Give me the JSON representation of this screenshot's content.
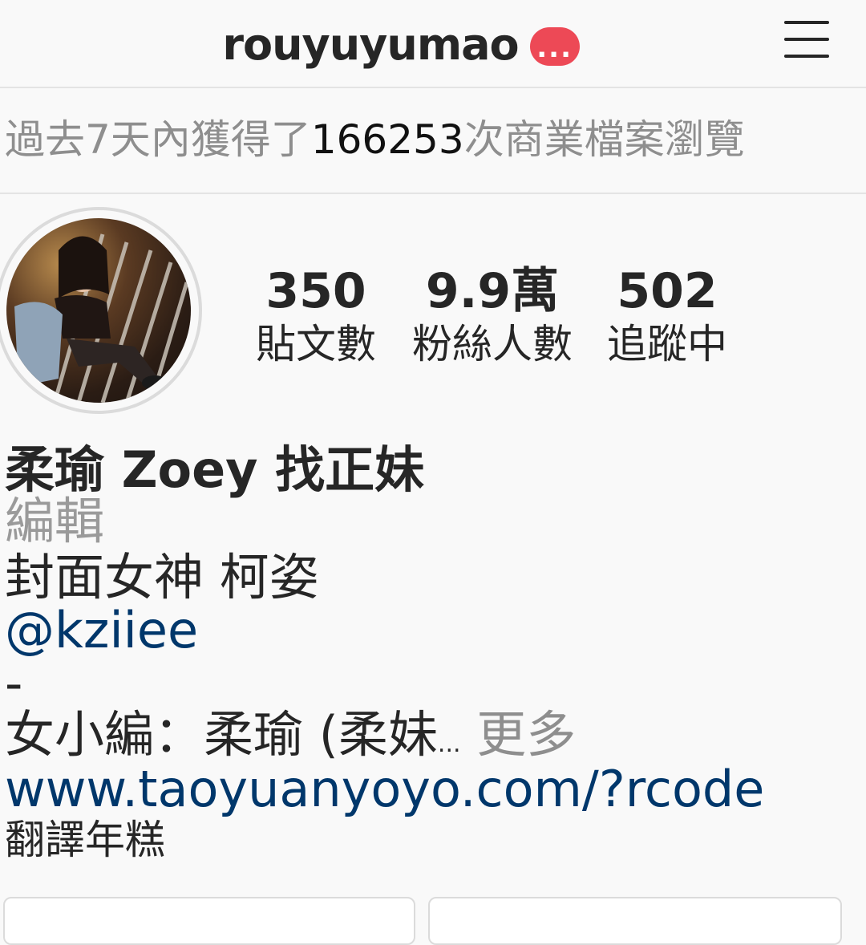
{
  "header": {
    "username": "rouyuyumao",
    "notification_glyph": "...",
    "menu_icon": "hamburger-menu-icon",
    "notification_color": "#ed4956"
  },
  "insights": {
    "prefix": "過去7天內獲得了",
    "count": "166253",
    "suffix": "次商業檔案瀏覽"
  },
  "stats": [
    {
      "value": "350",
      "label": "貼文數"
    },
    {
      "value": "9.9萬",
      "label": "粉絲人數"
    },
    {
      "value": "502",
      "label": "追蹤中"
    }
  ],
  "bio": {
    "name": "柔瑜 Zoey 找正妹",
    "category": "編輯",
    "line1": "封面女神 柯姿",
    "mention": "@kziiee",
    "dash": "-",
    "line2": "女小編：柔瑜 (柔妹",
    "ellipsis": "...",
    "more": "更多",
    "website": "www.taoyuanyoyo.com/?rcode",
    "translate": "翻譯年糕"
  },
  "colors": {
    "link": "#00376b",
    "muted": "#8e8e8e",
    "text": "#262626"
  }
}
